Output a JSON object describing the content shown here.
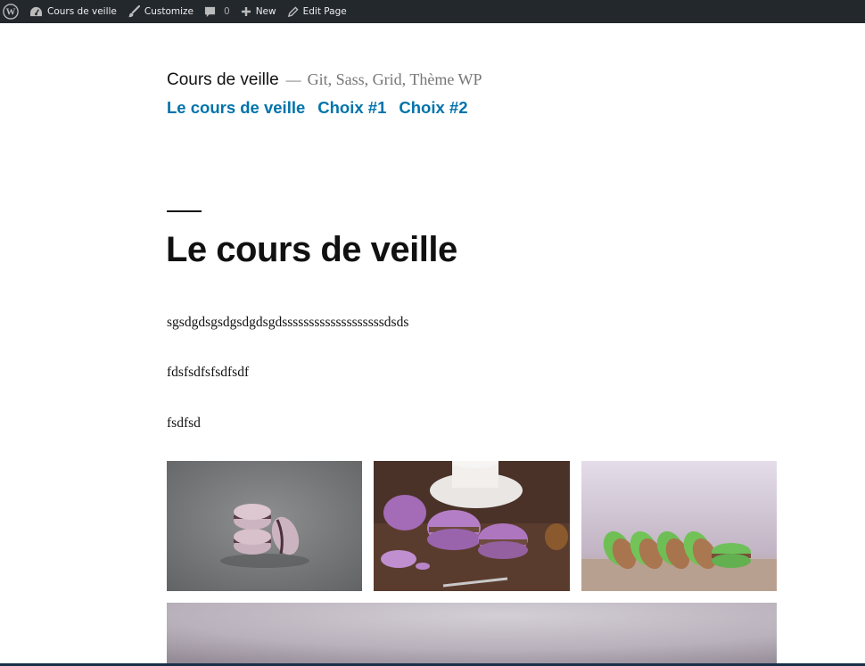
{
  "admin_bar": {
    "site_name": "Cours de veille",
    "customize": "Customize",
    "comments_count": "0",
    "new": "New",
    "edit_page": "Edit Page",
    "background": "#23282d"
  },
  "header": {
    "site_title": "Cours de veille",
    "separator": "—",
    "description": "Git, Sass, Grid, Thème WP",
    "nav": [
      {
        "label": "Le cours de veille"
      },
      {
        "label": "Choix #1"
      },
      {
        "label": "Choix #2"
      }
    ],
    "link_color": "#0073aa"
  },
  "page": {
    "title": "Le cours de veille",
    "paragraphs": [
      "sgsdgdsgsdgsdgdsgdsssssssssssssssssssdsds",
      "fdsfsdfsfsdfsdf",
      "fsdfsd"
    ]
  },
  "gallery": [
    {
      "icon": "macarons-stack-photo"
    },
    {
      "icon": "purple-macarons-coffee-photo"
    },
    {
      "icon": "green-macarons-row-photo"
    },
    {
      "icon": "wide-gradient-photo"
    }
  ]
}
